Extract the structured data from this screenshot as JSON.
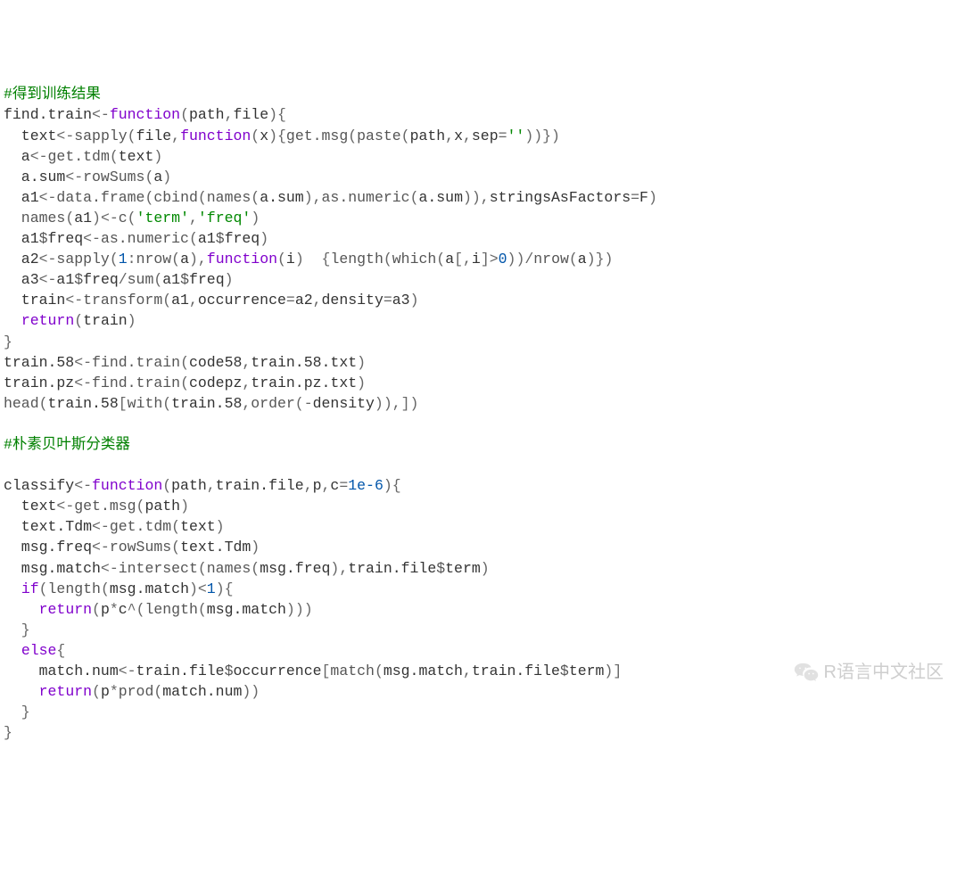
{
  "code": {
    "l01": "#得到训练结果",
    "l02a": "find.train",
    "l02b": "<-",
    "l02c": "function",
    "l02d": "(",
    "l02e": "path",
    "l02f": ",",
    "l02g": "file",
    "l02h": ")",
    "l02i": "{",
    "l03a": "  text",
    "l03b": "<-",
    "l03c": "sapply",
    "l03d": "(",
    "l03e": "file",
    "l03f": ",",
    "l03g": "function",
    "l03h": "(",
    "l03i": "x",
    "l03j": ")",
    "l03k": "{",
    "l03l": "get.msg",
    "l03m": "(",
    "l03n": "paste",
    "l03o": "(",
    "l03p": "path",
    "l03q": ",",
    "l03r": "x",
    "l03s": ",",
    "l03t": "sep",
    "l03u": "=",
    "l03v": "''",
    "l03w": ")",
    "l03x": ")",
    "l03y": "}",
    "l03z": ")",
    "l04a": "  a",
    "l04b": "<-",
    "l04c": "get.tdm",
    "l04d": "(",
    "l04e": "text",
    "l04f": ")",
    "l05a": "  a.sum",
    "l05b": "<-",
    "l05c": "rowSums",
    "l05d": "(",
    "l05e": "a",
    "l05f": ")",
    "l06a": "  a1",
    "l06b": "<-",
    "l06c": "data.frame",
    "l06d": "(",
    "l06e": "cbind",
    "l06f": "(",
    "l06g": "names",
    "l06h": "(",
    "l06i": "a.sum",
    "l06j": ")",
    "l06k": ",",
    "l06l": "as.numeric",
    "l06m": "(",
    "l06n": "a.sum",
    "l06o": ")",
    "l06p": ")",
    "l06q": ",",
    "l06r": "stringsAsFactors",
    "l06s": "=",
    "l06t": "F",
    "l06u": ")",
    "l07a": "  names",
    "l07b": "(",
    "l07c": "a1",
    "l07d": ")",
    "l07e": "<-",
    "l07f": "c",
    "l07g": "(",
    "l07h": "'term'",
    "l07i": ",",
    "l07j": "'freq'",
    "l07k": ")",
    "l08a": "  a1",
    "l08b": "$",
    "l08c": "freq",
    "l08d": "<-",
    "l08e": "as.numeric",
    "l08f": "(",
    "l08g": "a1",
    "l08h": "$",
    "l08i": "freq",
    "l08j": ")",
    "l09a": "  a2",
    "l09b": "<-",
    "l09c": "sapply",
    "l09d": "(",
    "l09e": "1",
    "l09f": ":",
    "l09g": "nrow",
    "l09h": "(",
    "l09i": "a",
    "l09j": ")",
    "l09k": ",",
    "l09l": "function",
    "l09m": "(",
    "l09n": "i",
    "l09o": ")",
    "l09p": "  {",
    "l09q": "length",
    "l09r": "(",
    "l09s": "which",
    "l09t": "(",
    "l09u": "a",
    "l09v": "[,",
    "l09w": "i",
    "l09x": "]",
    "l09y": ">",
    "l09z": "0",
    "l09aa": ")",
    "l09ab": ")",
    "l09ac": "/",
    "l09ad": "nrow",
    "l09ae": "(",
    "l09af": "a",
    "l09ag": ")",
    "l09ah": "}",
    "l09ai": ")",
    "l10a": "  a3",
    "l10b": "<-",
    "l10c": "a1",
    "l10d": "$",
    "l10e": "freq",
    "l10f": "/",
    "l10g": "sum",
    "l10h": "(",
    "l10i": "a1",
    "l10j": "$",
    "l10k": "freq",
    "l10l": ")",
    "l11a": "  train",
    "l11b": "<-",
    "l11c": "transform",
    "l11d": "(",
    "l11e": "a1",
    "l11f": ",",
    "l11g": "occurrence",
    "l11h": "=",
    "l11i": "a2",
    "l11j": ",",
    "l11k": "density",
    "l11l": "=",
    "l11m": "a3",
    "l11n": ")",
    "l12a": "  ",
    "l12b": "return",
    "l12c": "(",
    "l12d": "train",
    "l12e": ")",
    "l13a": "}",
    "l14a": "train.58",
    "l14b": "<-",
    "l14c": "find.train",
    "l14d": "(",
    "l14e": "code58",
    "l14f": ",",
    "l14g": "train.58.txt",
    "l14h": ")",
    "l15a": "train.pz",
    "l15b": "<-",
    "l15c": "find.train",
    "l15d": "(",
    "l15e": "codepz",
    "l15f": ",",
    "l15g": "train.pz.txt",
    "l15h": ")",
    "l16a": "head",
    "l16b": "(",
    "l16c": "train.58",
    "l16d": "[",
    "l16e": "with",
    "l16f": "(",
    "l16g": "train.58",
    "l16h": ",",
    "l16i": "order",
    "l16j": "(",
    "l16k": "-",
    "l16l": "density",
    "l16m": ")",
    "l16n": ")",
    "l16o": ",",
    "l16p": "]",
    "l16q": ")",
    "l17": "",
    "l18": "#朴素贝叶斯分类器",
    "l19": "",
    "l20a": "classify",
    "l20b": "<-",
    "l20c": "function",
    "l20d": "(",
    "l20e": "path",
    "l20f": ",",
    "l20g": "train.file",
    "l20h": ",",
    "l20i": "p",
    "l20j": ",",
    "l20k": "c",
    "l20l": "=",
    "l20m": "1e-6",
    "l20n": ")",
    "l20o": "{",
    "l21a": "  text",
    "l21b": "<-",
    "l21c": "get.msg",
    "l21d": "(",
    "l21e": "path",
    "l21f": ")",
    "l22a": "  text.Tdm",
    "l22b": "<-",
    "l22c": "get.tdm",
    "l22d": "(",
    "l22e": "text",
    "l22f": ")",
    "l23a": "  msg.freq",
    "l23b": "<-",
    "l23c": "rowSums",
    "l23d": "(",
    "l23e": "text.Tdm",
    "l23f": ")",
    "l24a": "  msg.match",
    "l24b": "<-",
    "l24c": "intersect",
    "l24d": "(",
    "l24e": "names",
    "l24f": "(",
    "l24g": "msg.freq",
    "l24h": ")",
    "l24i": ",",
    "l24j": "train.file",
    "l24k": "$",
    "l24l": "term",
    "l24m": ")",
    "l25a": "  ",
    "l25b": "if",
    "l25c": "(",
    "l25d": "length",
    "l25e": "(",
    "l25f": "msg.match",
    "l25g": ")",
    "l25h": "<",
    "l25i": "1",
    "l25j": ")",
    "l25k": "{",
    "l26a": "    ",
    "l26b": "return",
    "l26c": "(",
    "l26d": "p",
    "l26e": "*",
    "l26f": "c",
    "l26g": "^",
    "l26h": "(",
    "l26i": "length",
    "l26j": "(",
    "l26k": "msg.match",
    "l26l": ")",
    "l26m": ")",
    "l26n": ")",
    "l27a": "  }",
    "l28a": "  ",
    "l28b": "else",
    "l28c": "{",
    "l29a": "    match.num",
    "l29b": "<-",
    "l29c": "train.file",
    "l29d": "$",
    "l29e": "occurrence",
    "l29f": "[",
    "l29g": "match",
    "l29h": "(",
    "l29i": "msg.match",
    "l29j": ",",
    "l29k": "train.file",
    "l29l": "$",
    "l29m": "term",
    "l29n": ")",
    "l29o": "]",
    "l30a": "    ",
    "l30b": "return",
    "l30c": "(",
    "l30d": "p",
    "l30e": "*",
    "l30f": "prod",
    "l30g": "(",
    "l30h": "match.num",
    "l30i": ")",
    "l30j": ")",
    "l31a": "  }",
    "l32a": "}"
  },
  "watermark": "R语言中文社区"
}
